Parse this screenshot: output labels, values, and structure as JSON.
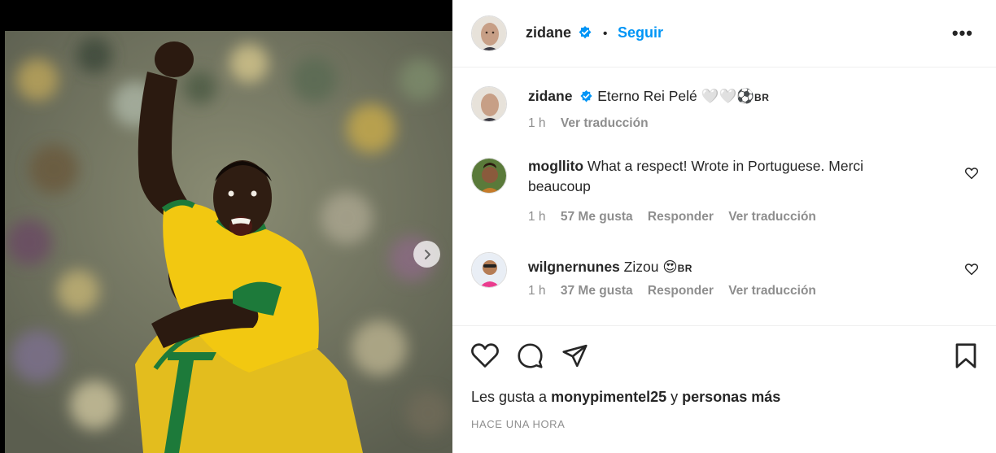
{
  "post": {
    "author": "zidane",
    "follow_label": "Seguir",
    "dot": "•",
    "more": "•••"
  },
  "comments": [
    {
      "username": "zidane",
      "text": "Eterno Rei Pelé 🤍🤍⚽",
      "flag": "BR",
      "time": "1 h",
      "likes": "",
      "reply": "",
      "translate": "Ver traducción"
    },
    {
      "username": "mogllito",
      "text_line1": "What a respect! Wrote in Portuguese. Merci",
      "text_line2": "beaucoup",
      "time": "1 h",
      "likes": "57 Me gusta",
      "reply": "Responder",
      "translate": "Ver traducción"
    },
    {
      "username": "wilgnernunes",
      "text": "Zizou 😍",
      "flag": "BR",
      "time": "1 h",
      "likes": "37 Me gusta",
      "reply": "Responder",
      "translate": "Ver traducción"
    }
  ],
  "footer": {
    "likes_prefix": "Les gusta a",
    "liked_by": "monypimentel25",
    "likes_join": "y",
    "likes_others": "personas más",
    "timestamp": "HACE UNA HORA"
  },
  "icons": {
    "verified": "verified-badge-icon",
    "next": "chevron-right-icon",
    "like": "heart-icon",
    "comment": "comment-icon",
    "share": "paper-plane-icon",
    "save": "bookmark-icon",
    "more": "more-options-icon"
  },
  "colors": {
    "follow": "#0095f6",
    "muted": "#8e8e8e",
    "text": "#262626",
    "verified": "#0095f6",
    "jersey": "#f2c811",
    "trim": "#1d7a3a"
  }
}
